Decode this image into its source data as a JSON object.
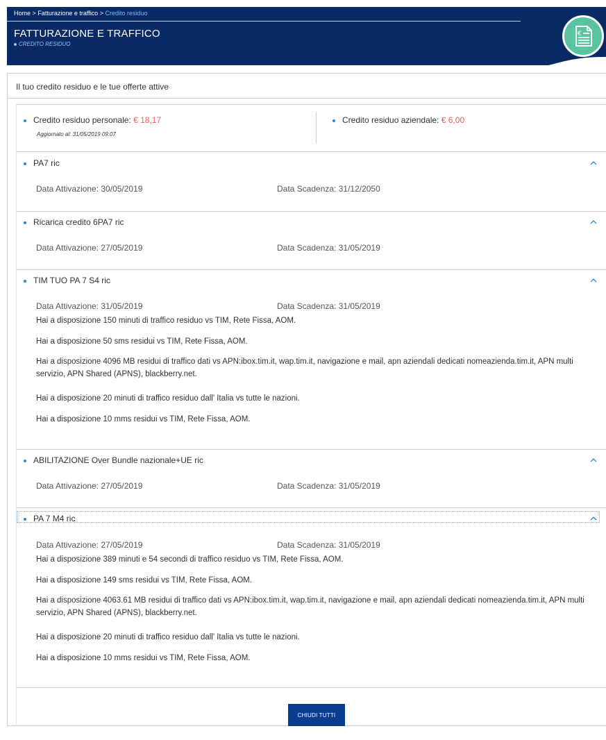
{
  "breadcrumb": {
    "items": [
      "Home",
      "Fatturazione e traffico"
    ],
    "separator": ">",
    "current": "Credito residuo"
  },
  "header": {
    "title": "FATTURAZIONE E TRAFFICO",
    "subtitle": "CREDITO RESIDUO",
    "badge_icon": "euro-document-icon",
    "colors": {
      "banner": "#0a2a66",
      "badge": "#59c3a2",
      "accent": "#e85b5b"
    }
  },
  "panel": {
    "title": "Il tuo credito residuo e le tue offerte attive"
  },
  "credit": {
    "personal_label": "Credito residuo personale:",
    "personal_value": "€ 18,17",
    "updated": "Aggiornato al: 31/05/2019 09:07",
    "business_label": "Credito residuo aziendale:",
    "business_value": "€ 6,00"
  },
  "offers": [
    {
      "name": "PA7 ric",
      "activation": "Data Attivazione: 30/05/2019",
      "expiry": "Data Scadenza: 31/12/2050",
      "details": []
    },
    {
      "name": "Ricarica credito 6PA7 ric",
      "activation": "Data Attivazione: 27/05/2019",
      "expiry": "Data Scadenza: 31/05/2019",
      "details": []
    },
    {
      "name": "TIM TUO PA 7 S4 ric",
      "activation": "Data Attivazione: 31/05/2019",
      "expiry": "Data Scadenza: 31/05/2019",
      "details": [
        "Hai a disposizione 150 minuti di traffico residuo vs TIM, Rete Fissa, AOM.",
        "Hai a disposizione 50 sms residui vs TIM, Rete Fissa, AOM.",
        "Hai a disposizione 4096 MB residui di traffico dati vs APN:ibox.tim.it, wap.tim.it, navigazione e mail, apn aziendali dedicati nomeazienda.tim.it, APN multi servizio, APN Shared (APNS), blackberry.net.",
        "Hai a disposizione 20 minuti di traffico residuo dall' Italia vs tutte le nazioni.",
        "Hai a disposizione 10 mms residui vs TIM, Rete Fissa, AOM."
      ]
    },
    {
      "name": "ABILITAZIONE Over Bundle nazionale+UE ric",
      "activation": "Data Attivazione: 27/05/2019",
      "expiry": "Data Scadenza: 31/05/2019",
      "details": []
    },
    {
      "name": "PA 7 M4 ric",
      "activation": "Data Attivazione: 27/05/2019",
      "expiry": "Data Scadenza: 31/05/2019",
      "details": [
        "Hai a disposizione 389 minuti e 54 secondi di traffico residuo vs TIM, Rete Fissa, AOM.",
        "Hai a disposizione 149 sms residui vs TIM, Rete Fissa, AOM.",
        "Hai a disposizione 4063.61 MB residui di traffico dati vs APN:ibox.tim.it, wap.tim.it, navigazione e mail, apn aziendali dedicati nomeazienda.tim.it, APN multi servizio, APN Shared (APNS), blackberry.net.",
        "Hai a disposizione 20 minuti di traffico residuo dall' Italia vs tutte le nazioni.",
        "Hai a disposizione 10 mms residui vs TIM, Rete Fissa, AOM."
      ]
    }
  ],
  "actions": {
    "close_all_label": "CHIUDI TUTTI"
  }
}
